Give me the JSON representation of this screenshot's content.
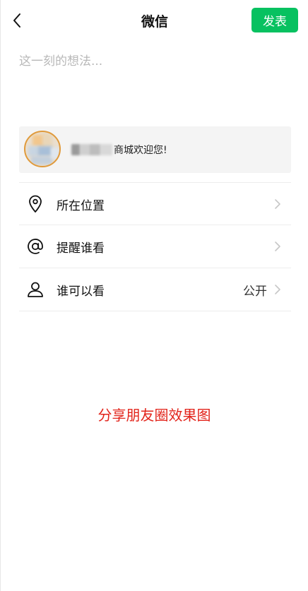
{
  "colors": {
    "accent": "#07c160",
    "caption": "#e2231a",
    "divider": "#ededed",
    "card_bg": "#f4f4f4"
  },
  "header": {
    "back_icon": "chevron-left-icon",
    "title": "微信",
    "publish_label": "发表"
  },
  "compose": {
    "placeholder": "这一刻的想法...",
    "value": ""
  },
  "share_card": {
    "thumbnail": "blurred-avatar-image",
    "title_suffix": "商城欢迎您!"
  },
  "options": [
    {
      "icon": "location-pin-icon",
      "label": "所在位置",
      "value": ""
    },
    {
      "icon": "at-sign-icon",
      "label": "提醒谁看",
      "value": ""
    },
    {
      "icon": "person-icon",
      "label": "谁可以看",
      "value": "公开"
    }
  ],
  "caption": "分享朋友圈效果图"
}
